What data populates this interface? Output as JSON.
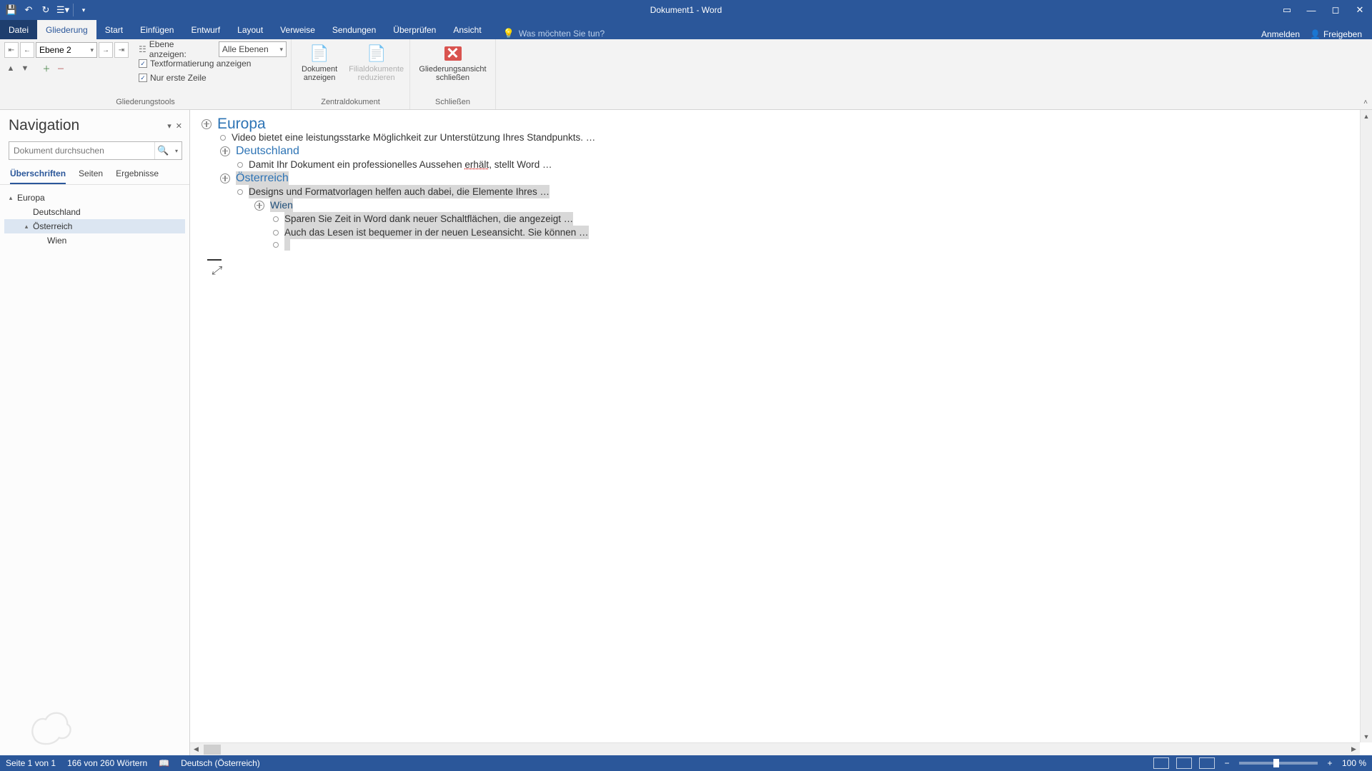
{
  "title": "Dokument1 - Word",
  "tabs": {
    "file": "Datei",
    "outlining": "Gliederung",
    "home": "Start",
    "insert": "Einfügen",
    "design": "Entwurf",
    "layout": "Layout",
    "references": "Verweise",
    "mailings": "Sendungen",
    "review": "Überprüfen",
    "view": "Ansicht"
  },
  "tellme_placeholder": "Was möchten Sie tun?",
  "signin": "Anmelden",
  "share": "Freigeben",
  "ribbon": {
    "outline_level": "Ebene 2",
    "show_level_label": "Ebene anzeigen:",
    "show_level_value": "Alle Ebenen",
    "show_formatting": "Textformatierung anzeigen",
    "first_line_only": "Nur erste Zeile",
    "group_tools": "Gliederungstools",
    "show_doc": "Dokument anzeigen",
    "collapse_sub": "Filialdokumente reduzieren",
    "group_master": "Zentraldokument",
    "close_view": "Gliederungsansicht schließen",
    "group_close": "Schließen"
  },
  "nav": {
    "title": "Navigation",
    "search_placeholder": "Dokument durchsuchen",
    "tab_headings": "Überschriften",
    "tab_pages": "Seiten",
    "tab_results": "Ergebnisse",
    "tree": {
      "n0": "Europa",
      "n1": "Deutschland",
      "n2": "Österreich",
      "n3": "Wien"
    }
  },
  "doc": {
    "h1": "Europa",
    "b1": "Video bietet eine leistungsstarke Möglichkeit zur Unterstützung Ihres Standpunkts. …",
    "h2a": "Deutschland",
    "b2_pre": "Damit Ihr Dokument ein professionelles Aussehen ",
    "b2_mid": "erhält",
    "b2_post": ", stellt Word …",
    "h2b": "Österreich",
    "b3": "Designs und Formatvorlagen helfen auch dabei, die Elemente Ihres …",
    "h3": "Wien",
    "b4": "Sparen Sie Zeit in Word dank neuer Schaltflächen, die angezeigt …",
    "b5": "Auch das Lesen ist bequemer in der neuen Leseansicht. Sie können …"
  },
  "status": {
    "page": "Seite 1 von 1",
    "words": "166 von 260 Wörtern",
    "lang": "Deutsch (Österreich)",
    "zoom": "100 %"
  }
}
